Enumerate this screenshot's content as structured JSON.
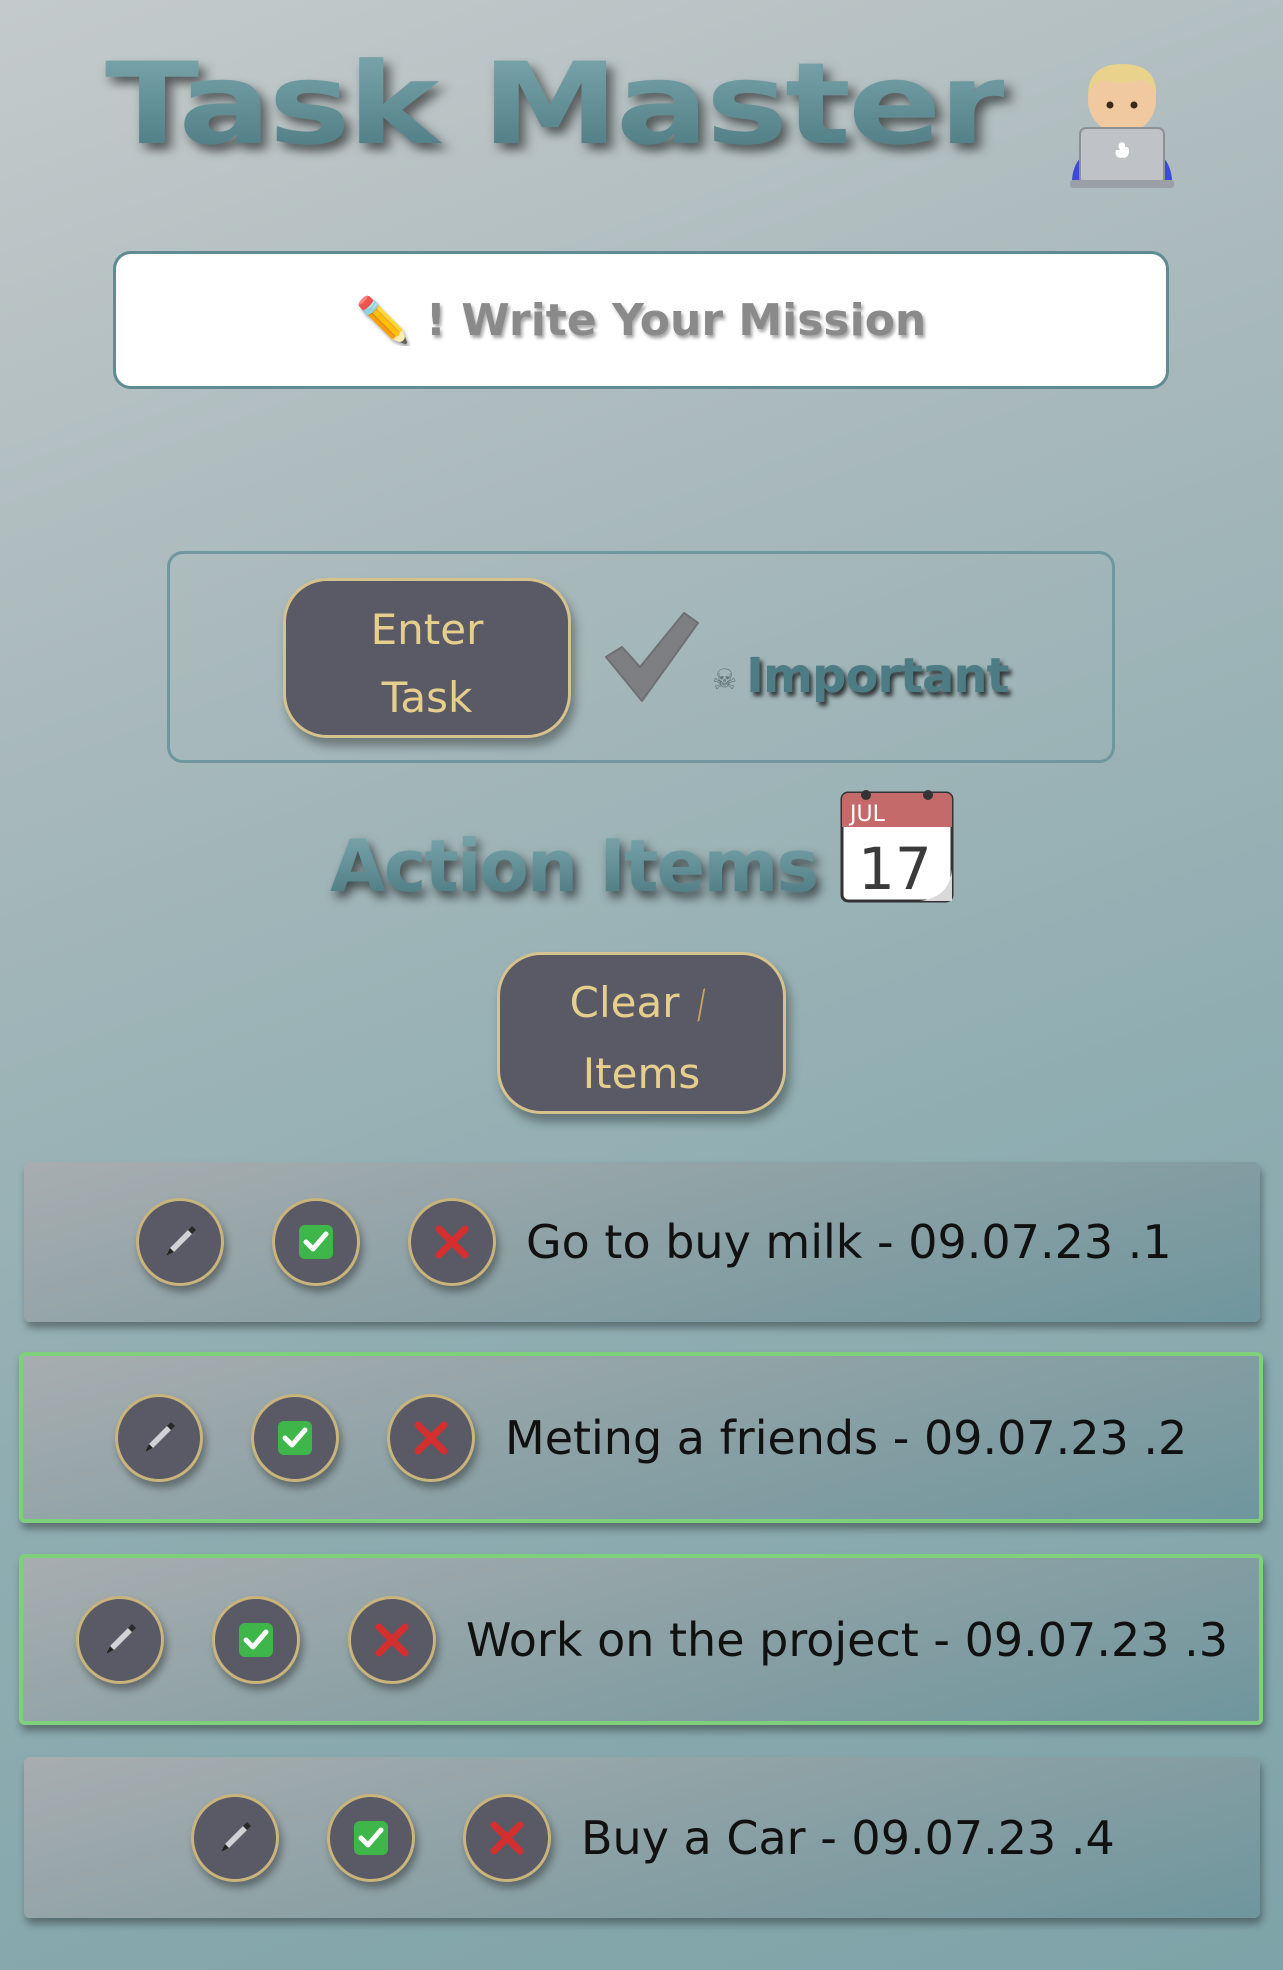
{
  "app": {
    "title": "Task Master",
    "avatar_icon": "technologist-icon"
  },
  "input": {
    "placeholder": "✏️ ! Write Your Mission",
    "value": ""
  },
  "controls": {
    "enter_button_line1": "Enter",
    "enter_button_line2": "Task",
    "important_checkbox_icon": "checkmark-icon",
    "important_checkbox_checked": true,
    "important_icon": "skull-icon",
    "important_label": "Important"
  },
  "section": {
    "title": "Action Items",
    "calendar_month": "JUL",
    "calendar_day": "17"
  },
  "clear_button": {
    "line1": "Clear",
    "line2": "Items",
    "icon": "broom-icon"
  },
  "tasks": [
    {
      "text": "Go to buy milk - 09.07.23 .1",
      "completed": false
    },
    {
      "text": "Meting a friends - 09.07.23 .2",
      "completed": true
    },
    {
      "text": "Work on the project - 09.07.23 .3",
      "completed": true
    },
    {
      "text": "Buy a Car - 09.07.23 .4",
      "completed": false
    }
  ],
  "colors": {
    "button_bg": "#5a5a66",
    "button_border": "#d6c28c",
    "button_text": "#e6cf8d",
    "title_teal": "#5f8a91",
    "done_border": "#7fd07a",
    "check_green": "#3fb64a",
    "cross_red": "#d32f2f"
  }
}
